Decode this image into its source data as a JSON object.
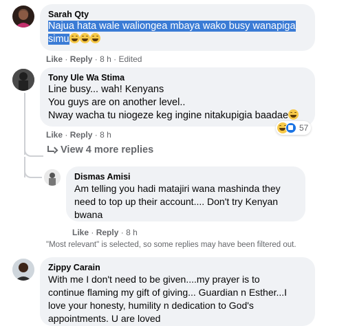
{
  "comments": [
    {
      "author": "Sarah Qty",
      "text_highlighted": "Najua hata wale waliongea mbaya wako busy wanapiga simu",
      "emoji_count": 3,
      "actions": {
        "like": "Like",
        "reply": "Reply",
        "time": "8 h",
        "edited": "Edited",
        "sep": "·"
      }
    },
    {
      "author": "Tony Ule Wa Stima",
      "lines": [
        "Line busy... wah! Kenyans",
        "You guys are on another level..",
        "Nway wacha tu niogeze keg ingine nitakupigia baadae"
      ],
      "actions": {
        "like": "Like",
        "reply": "Reply",
        "time": "8 h",
        "sep": "·"
      },
      "reactions": {
        "count": "57",
        "icons": [
          "laugh-icon",
          "like-icon"
        ]
      },
      "view_replies": "View 4 more replies"
    },
    {
      "author": "Dismas Amisi",
      "lines": [
        "Am telling you hadi matajiri wana mashinda they",
        "need to top up their account.... Don't try Kenyan",
        "bwana"
      ],
      "actions": {
        "like": "Like",
        "reply": "Reply",
        "time": "8 h",
        "sep": "·"
      }
    },
    {
      "author": "Zippy Carain",
      "lines": [
        "With me I don't need to be given....my prayer is to",
        "continue flaming my gift of giving... Guardian n Esther...I",
        "love your honesty, humility n dedication to God's",
        "appointments. U are loved"
      ]
    }
  ],
  "filter_note": "\"Most relevant\" is selected, so some replies may have been filtered out.",
  "colors": {
    "bubble": "#f0f2f5",
    "meta": "#65676b",
    "highlight": "#3a7bd5",
    "like_blue": "#1b74e4"
  }
}
